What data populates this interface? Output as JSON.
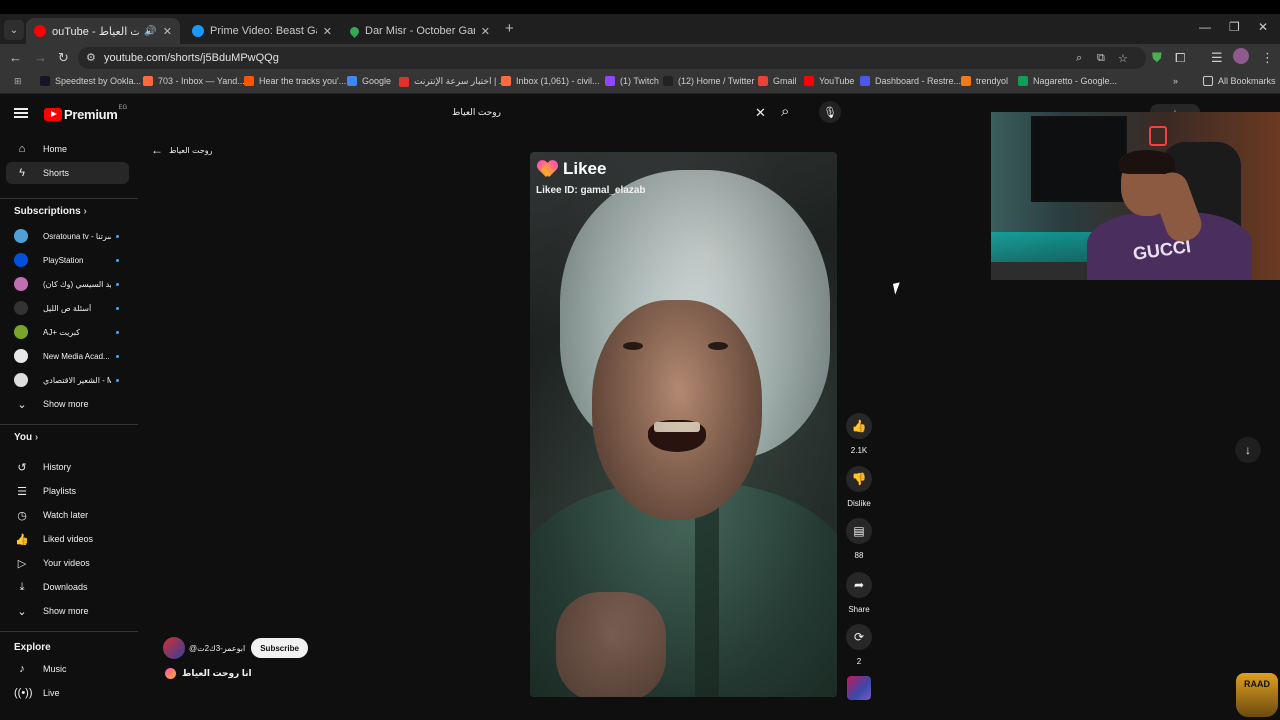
{
  "browser": {
    "tabs": [
      {
        "title": "ouTube - انا روحت العياط",
        "active": true,
        "favicon_color": "#ff0000",
        "has_audio": true
      },
      {
        "title": "Prime Video: Beast Games - Se",
        "active": false,
        "favicon_color": "#1a98ff"
      },
      {
        "title": "Dar Misr - October Gardens to",
        "active": false,
        "favicon_color": "#34a853"
      }
    ],
    "url": "youtube.com/shorts/j5BduMPwQQg",
    "bookmarks": [
      {
        "label": "Speedtest by Ookla...",
        "color": "#141526"
      },
      {
        "label": "703 - Inbox — Yand...",
        "color": "#ff6a3d"
      },
      {
        "label": "Hear the tracks you'...",
        "color": "#ff5500"
      },
      {
        "label": "Google",
        "color": "#4285f4"
      },
      {
        "label": "اختبار سرعة الإنترنت | ...",
        "color": "#e0312b"
      },
      {
        "label": "Inbox (1,061) - civil...",
        "color": "#ff6a3d"
      },
      {
        "label": "(1) Twitch",
        "color": "#9146ff"
      },
      {
        "label": "(12) Home / Twitter",
        "color": "#222222"
      },
      {
        "label": "Gmail",
        "color": "#ea4335"
      },
      {
        "label": "YouTube",
        "color": "#ff0000"
      },
      {
        "label": "Dashboard - Restre...",
        "color": "#4a5ae8"
      },
      {
        "label": "trendyol",
        "color": "#f27a1a"
      },
      {
        "label": "Nagaretto - Google...",
        "color": "#0f9d58"
      }
    ],
    "all_bookmarks": "All Bookmarks"
  },
  "youtube": {
    "logo_text": "Premium",
    "logo_country": "EG",
    "search_query": "روحت العياط",
    "nav": [
      {
        "label": "Home",
        "icon": "home-icon",
        "glyph": "⌂"
      },
      {
        "label": "Shorts",
        "icon": "shorts-icon",
        "glyph": "ϟ",
        "active": true
      }
    ],
    "subscriptions_title": "Subscriptions",
    "subscriptions": [
      {
        "name": "Osratouna tv - اسرتنا",
        "color": "#4fa0d8"
      },
      {
        "name": "PlayStation",
        "color": "#0050d8"
      },
      {
        "name": "اللواء وليد السيسي (وك كان)",
        "color": "#c070b0"
      },
      {
        "name": "أسئلة ص الليل",
        "color": "#333333"
      },
      {
        "name": "AJ+ كبريت",
        "color": "#7aa52b"
      },
      {
        "name": "New Media Acad...",
        "color": "#e8e8e8"
      },
      {
        "name": "الشعير الاقتصادي - M...",
        "color": "#dddddd"
      }
    ],
    "show_more": "Show more",
    "you_title": "You",
    "you_items": [
      {
        "label": "History",
        "icon": "history-icon",
        "glyph": "↺"
      },
      {
        "label": "Playlists",
        "icon": "playlists-icon",
        "glyph": "☰"
      },
      {
        "label": "Watch later",
        "icon": "watch-later-icon",
        "glyph": "◷"
      },
      {
        "label": "Liked videos",
        "icon": "liked-videos-icon",
        "glyph": "👍"
      },
      {
        "label": "Your videos",
        "icon": "your-videos-icon",
        "glyph": "▷"
      },
      {
        "label": "Downloads",
        "icon": "downloads-icon",
        "glyph": "⤓"
      }
    ],
    "show_more_2": "Show more",
    "explore_title": "Explore",
    "explore_items": [
      {
        "label": "Music",
        "icon": "music-icon",
        "glyph": "♪"
      },
      {
        "label": "Live",
        "icon": "live-icon",
        "glyph": "((•))"
      }
    ],
    "back_label": "روحت العياط",
    "short": {
      "overlay_brand": "Likee",
      "overlay_id": "Likee ID: gamal_elazab",
      "likes": "2.1K",
      "dislike_label": "Dislike",
      "comments": "88",
      "share_label": "Share",
      "remix_count": "2",
      "channel_handle": "@ابوعمر-3ك2ت",
      "subscribe_label": "Subscribe",
      "title": "انا روحت العياط"
    }
  },
  "overlay": {
    "facecam_shirt_text": "GUCCI",
    "watermark": "RAAD"
  }
}
